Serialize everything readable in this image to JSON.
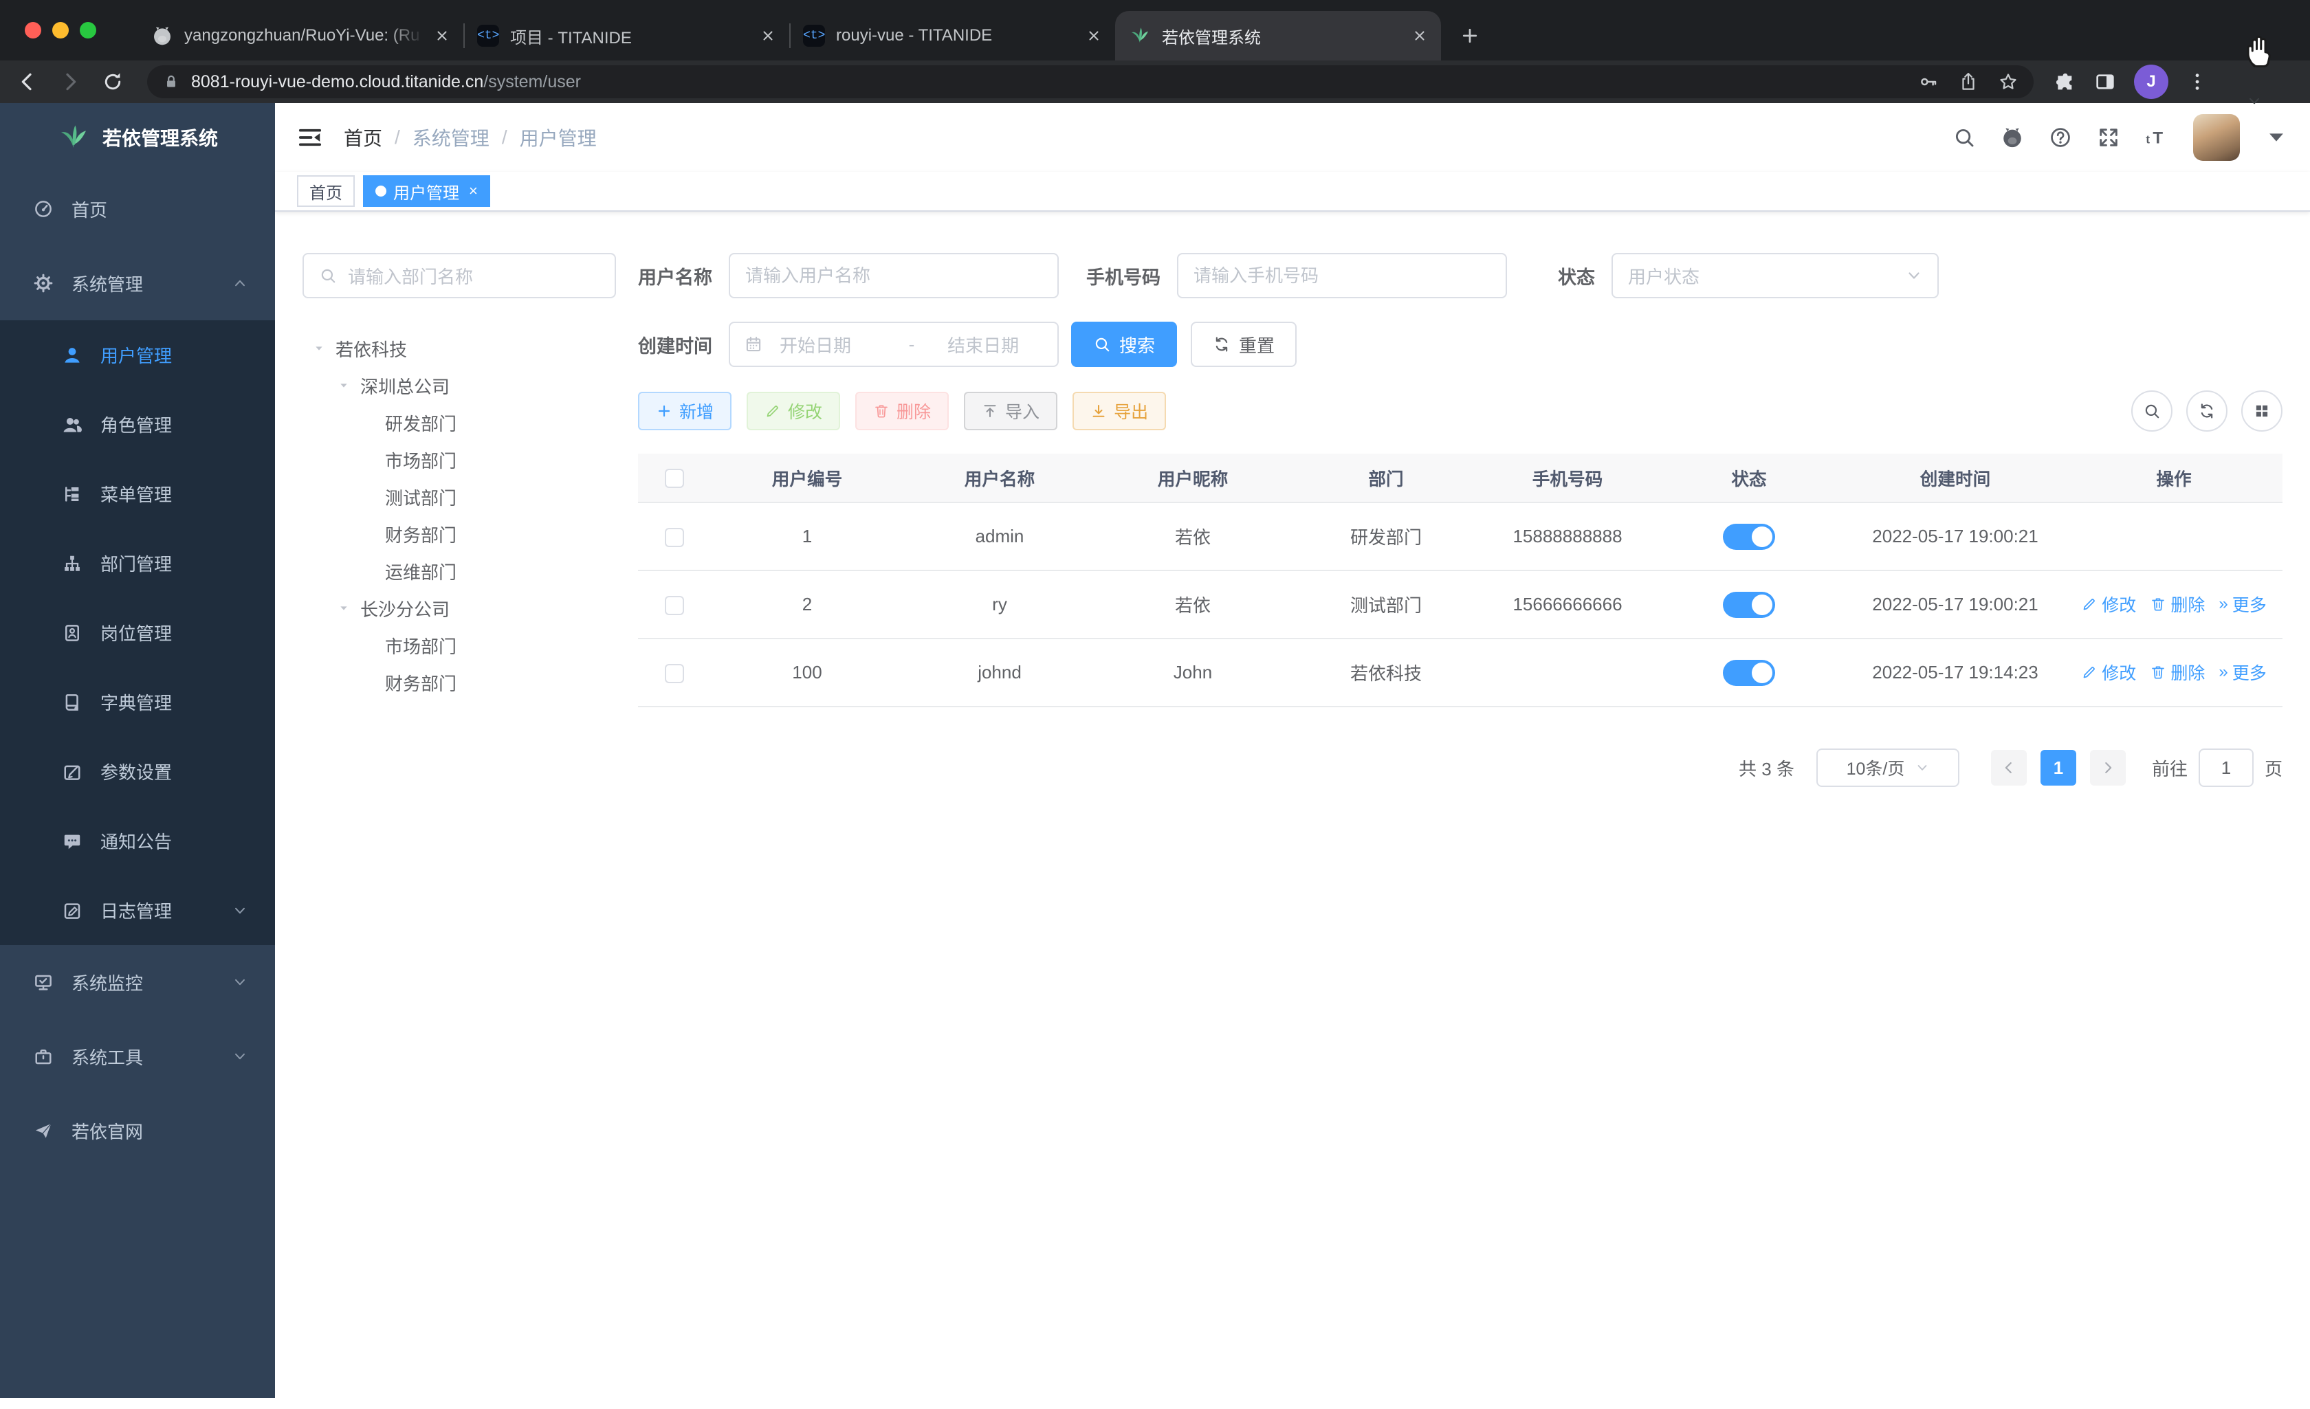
{
  "colors": {
    "accent": "#409eff",
    "sidebar_bg": "#304156",
    "submenu_bg": "#1f2d3d",
    "tag_active_bg": "#409eff",
    "toggle_on": "#409eff"
  },
  "browser": {
    "tabs": [
      {
        "title": "yangzongzhuan/RuoYi-Vue: (Ru",
        "favicon": "github",
        "active": false
      },
      {
        "title": "项目 - TITANIDE",
        "favicon": "titanide",
        "active": false
      },
      {
        "title": "rouyi-vue - TITANIDE",
        "favicon": "titanide",
        "active": false
      },
      {
        "title": "若依管理系统",
        "favicon": "ruoyi",
        "active": true
      }
    ],
    "titanide_glyph": "<t>",
    "url": {
      "host": "8081-rouyi-vue-demo.cloud.titanide.cn",
      "path": "/system/user"
    },
    "profile_initial": "J"
  },
  "sidebar": {
    "logo_title": "若依管理系统",
    "menu": [
      {
        "label": "首页",
        "icon": "gauge"
      },
      {
        "label": "系统管理",
        "icon": "gear",
        "arrow": "chevron-up"
      },
      {
        "label": "用户管理",
        "icon": "user",
        "sub": true,
        "active": true
      },
      {
        "label": "角色管理",
        "icon": "users",
        "sub": true
      },
      {
        "label": "菜单管理",
        "icon": "menu-tree",
        "sub": true
      },
      {
        "label": "部门管理",
        "icon": "org",
        "sub": true
      },
      {
        "label": "岗位管理",
        "icon": "badge",
        "sub": true
      },
      {
        "label": "字典管理",
        "icon": "book",
        "sub": true
      },
      {
        "label": "参数设置",
        "icon": "edit-square",
        "sub": true
      },
      {
        "label": "通知公告",
        "icon": "message",
        "sub": true
      },
      {
        "label": "日志管理",
        "icon": "log",
        "sub": true,
        "arrow": "chevron-down"
      },
      {
        "label": "系统监控",
        "icon": "monitor",
        "arrow": "chevron-down"
      },
      {
        "label": "系统工具",
        "icon": "briefcase",
        "arrow": "chevron-down"
      },
      {
        "label": "若依官网",
        "icon": "plane"
      }
    ]
  },
  "navbar": {
    "breadcrumb": [
      "首页",
      "系统管理",
      "用户管理"
    ]
  },
  "tags": [
    {
      "label": "首页",
      "active": false,
      "closable": false
    },
    {
      "label": "用户管理",
      "active": true,
      "closable": true
    }
  ],
  "dept_panel": {
    "search_placeholder": "请输入部门名称",
    "tree": [
      {
        "label": "若依科技",
        "level": 0,
        "caret": true
      },
      {
        "label": "深圳总公司",
        "level": 1,
        "caret": true
      },
      {
        "label": "研发部门",
        "level": 2,
        "caret": false
      },
      {
        "label": "市场部门",
        "level": 2,
        "caret": false
      },
      {
        "label": "测试部门",
        "level": 2,
        "caret": false
      },
      {
        "label": "财务部门",
        "level": 2,
        "caret": false
      },
      {
        "label": "运维部门",
        "level": 2,
        "caret": false
      },
      {
        "label": "长沙分公司",
        "level": 1,
        "caret": true
      },
      {
        "label": "市场部门",
        "level": 2,
        "caret": false
      },
      {
        "label": "财务部门",
        "level": 2,
        "caret": false
      }
    ]
  },
  "filters": {
    "username": {
      "label": "用户名称",
      "placeholder": "请输入用户名称"
    },
    "phone": {
      "label": "手机号码",
      "placeholder": "请输入手机号码"
    },
    "status": {
      "label": "状态",
      "placeholder": "用户状态"
    },
    "created": {
      "label": "创建时间",
      "start_placeholder": "开始日期",
      "separator": "-",
      "end_placeholder": "结束日期"
    },
    "search_label": "搜索",
    "reset_label": "重置"
  },
  "toolbar": {
    "add": "新增",
    "edit": "修改",
    "delete": "删除",
    "import": "导入",
    "export": "导出"
  },
  "table": {
    "headers": [
      "用户编号",
      "用户名称",
      "用户昵称",
      "部门",
      "手机号码",
      "状态",
      "创建时间",
      "操作"
    ],
    "rows": [
      {
        "id": "1",
        "username": "admin",
        "nickname": "若依",
        "dept": "研发部门",
        "phone": "15888888888",
        "status_on": true,
        "created": "2022-05-17 19:00:21",
        "ops": false
      },
      {
        "id": "2",
        "username": "ry",
        "nickname": "若依",
        "dept": "测试部门",
        "phone": "15666666666",
        "status_on": true,
        "created": "2022-05-17 19:00:21",
        "ops": true
      },
      {
        "id": "100",
        "username": "johnd",
        "nickname": "John",
        "dept": "若依科技",
        "phone": "",
        "status_on": true,
        "created": "2022-05-17 19:14:23",
        "ops": true
      }
    ],
    "op_labels": {
      "edit": "修改",
      "delete": "删除",
      "more": "更多"
    }
  },
  "pagination": {
    "total": "共 3 条",
    "page_size": "10条/页",
    "current": "1",
    "goto_label": "前往",
    "goto_value": "1",
    "page_unit": "页"
  }
}
